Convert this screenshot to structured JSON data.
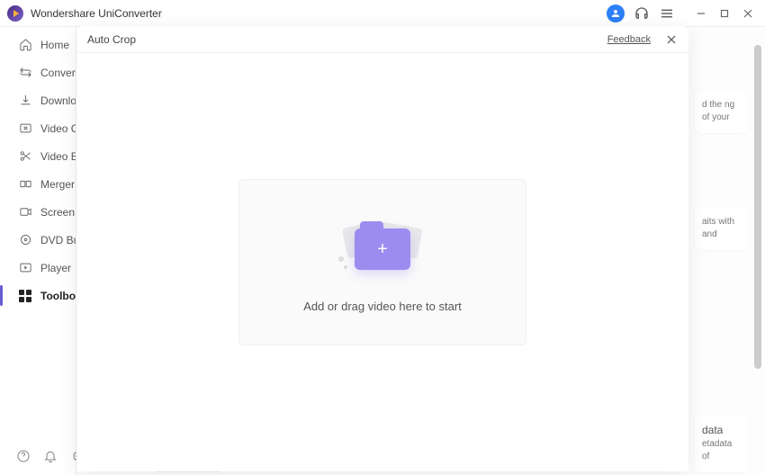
{
  "app": {
    "title": "Wondershare UniConverter"
  },
  "sidebar": {
    "items": [
      {
        "label": "Home"
      },
      {
        "label": "Converter"
      },
      {
        "label": "Downloader"
      },
      {
        "label": "Video Compressor"
      },
      {
        "label": "Video Editor"
      },
      {
        "label": "Merger"
      },
      {
        "label": "Screen Recorder"
      },
      {
        "label": "DVD Burner"
      },
      {
        "label": "Player"
      },
      {
        "label": "Toolbox"
      }
    ]
  },
  "modal": {
    "title": "Auto Crop",
    "feedback": "Feedback",
    "dropzone_text": "Add or drag video here to start"
  },
  "bg": {
    "card1": "d the ng of your",
    "card2": "aits with and",
    "card3_title": "data",
    "card3_text": "etadata of"
  }
}
